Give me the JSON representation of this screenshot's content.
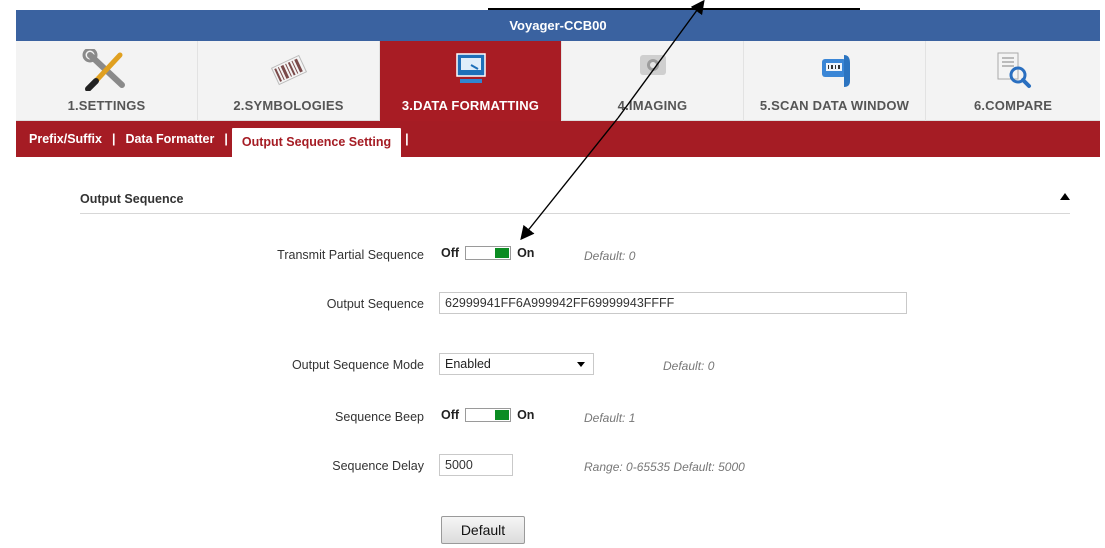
{
  "window": {
    "title": "Voyager-CCB00"
  },
  "tabs": [
    {
      "label": "1.SETTINGS",
      "icon": "tools-icon",
      "active": false
    },
    {
      "label": "2.SYMBOLOGIES",
      "icon": "barcode-icon",
      "active": false
    },
    {
      "label": "3.DATA FORMATTING",
      "icon": "monitor-icon",
      "active": true
    },
    {
      "label": "4.IMAGING",
      "icon": "camera-icon",
      "active": false
    },
    {
      "label": "5.SCAN DATA WINDOW",
      "icon": "scanner-icon",
      "active": false
    },
    {
      "label": "6.COMPARE",
      "icon": "compare-document-icon",
      "active": false
    }
  ],
  "subnav": {
    "items": [
      "Prefix/Suffix",
      "Data Formatter",
      "Output Sequence Setting"
    ],
    "separator": "|",
    "active_index": 2
  },
  "section": {
    "title": "Output Sequence"
  },
  "toggle_labels": {
    "off": "Off",
    "on": "On"
  },
  "fields": {
    "transmit_partial": {
      "label": "Transmit Partial Sequence",
      "value": "On",
      "default": "Default: 0"
    },
    "output_sequence": {
      "label": "Output Sequence",
      "value": "62999941FF6A999942FF69999943FFFF"
    },
    "output_mode": {
      "label": "Output Sequence Mode",
      "value": "Enabled",
      "default": "Default: 0"
    },
    "sequence_beep": {
      "label": "Sequence Beep",
      "value": "On",
      "default": "Default: 1"
    },
    "sequence_delay": {
      "label": "Sequence Delay",
      "value": "5000",
      "range": "Range: 0-65535  Default: 5000"
    }
  },
  "buttons": {
    "default": "Default"
  },
  "colors": {
    "title_bar": "#3a62a0",
    "brand_red": "#a51c24",
    "toggle_on": "#0b8c22"
  }
}
